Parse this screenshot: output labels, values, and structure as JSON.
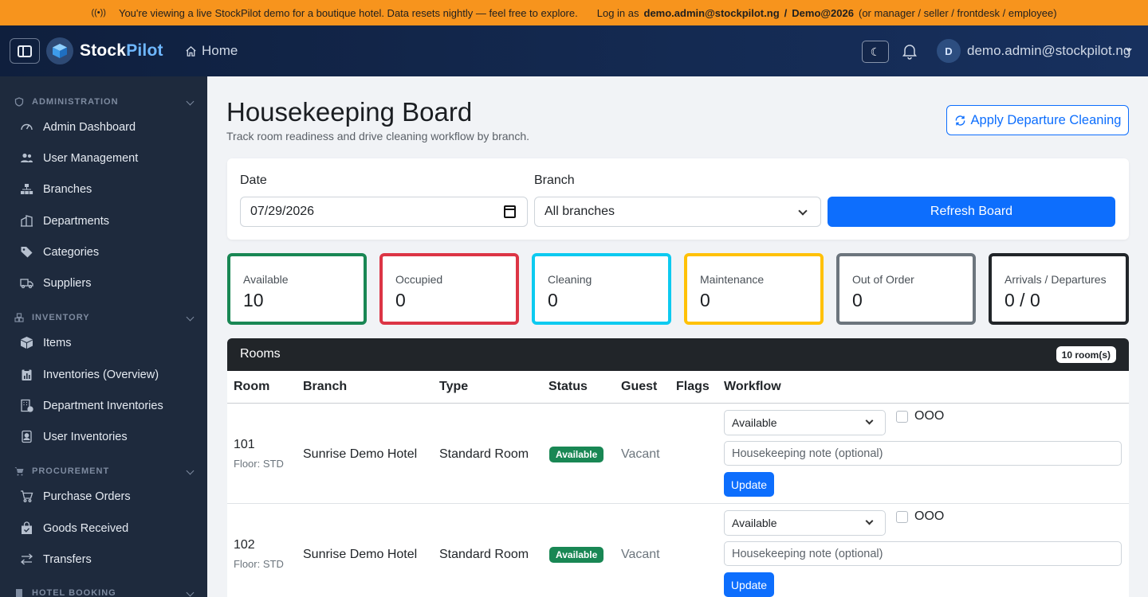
{
  "banner": {
    "text_main": "You're viewing a live StockPilot demo for a boutique hotel. Data resets nightly — feel free to explore.",
    "login_prefix": "Log in as",
    "login_email": "demo.admin@stockpilot.ng",
    "login_sep": "/",
    "login_password": "Demo@2026",
    "login_roles": "(or manager / seller / frontdesk / employee)"
  },
  "navbar": {
    "brand_stock": "Stock",
    "brand_pilot": "Pilot",
    "home_label": "Home",
    "avatar_initial": "D",
    "user_email": "demo.admin@stockpilot.ng"
  },
  "sidebar": {
    "sections": [
      {
        "title": "ADMINISTRATION",
        "items": [
          "Admin Dashboard",
          "User Management",
          "Branches",
          "Departments",
          "Categories",
          "Suppliers"
        ]
      },
      {
        "title": "INVENTORY",
        "items": [
          "Items",
          "Inventories (Overview)",
          "Department Inventories",
          "User Inventories"
        ]
      },
      {
        "title": "PROCUREMENT",
        "items": [
          "Purchase Orders",
          "Goods Received",
          "Transfers"
        ]
      },
      {
        "title": "HOTEL BOOKING",
        "items": []
      }
    ]
  },
  "page": {
    "title": "Housekeeping Board",
    "subtitle": "Track room readiness and drive cleaning workflow by branch.",
    "departure_button": "Apply Departure Cleaning"
  },
  "filters": {
    "date_label": "Date",
    "date_value": "07/29/2026",
    "branch_label": "Branch",
    "branch_value": "All branches",
    "refresh_button": "Refresh Board"
  },
  "stats": [
    {
      "label": "Available",
      "value": "10",
      "color": "#198754"
    },
    {
      "label": "Occupied",
      "value": "0",
      "color": "#dc3545"
    },
    {
      "label": "Cleaning",
      "value": "0",
      "color": "#0dcaf0"
    },
    {
      "label": "Maintenance",
      "value": "0",
      "color": "#ffc107"
    },
    {
      "label": "Out of Order",
      "value": "0",
      "color": "#6c757d"
    },
    {
      "label": "Arrivals / Departures",
      "value": "0 / 0",
      "color": "#212529"
    }
  ],
  "rooms": {
    "title": "Rooms",
    "count_badge": "10 room(s)",
    "columns": [
      "Room",
      "Branch",
      "Type",
      "Status",
      "Guest",
      "Flags",
      "Workflow"
    ],
    "rows": [
      {
        "room": "101",
        "floor": "Floor: STD",
        "branch": "Sunrise Demo Hotel",
        "type": "Standard Room",
        "status": "Available",
        "guest": "Vacant",
        "workflow_value": "Available",
        "ooo_label": "OOO",
        "note_placeholder": "Housekeeping note (optional)",
        "update_label": "Update"
      },
      {
        "room": "102",
        "floor": "Floor: STD",
        "branch": "Sunrise Demo Hotel",
        "type": "Standard Room",
        "status": "Available",
        "guest": "Vacant",
        "workflow_value": "Available",
        "ooo_label": "OOO",
        "note_placeholder": "Housekeeping note (optional)",
        "update_label": "Update"
      }
    ]
  },
  "colors": {
    "banner": "#f7941d",
    "navbar": "#142a52",
    "sidebar": "#1e2a3d",
    "primary": "#0d6efd",
    "success": "#198754"
  }
}
